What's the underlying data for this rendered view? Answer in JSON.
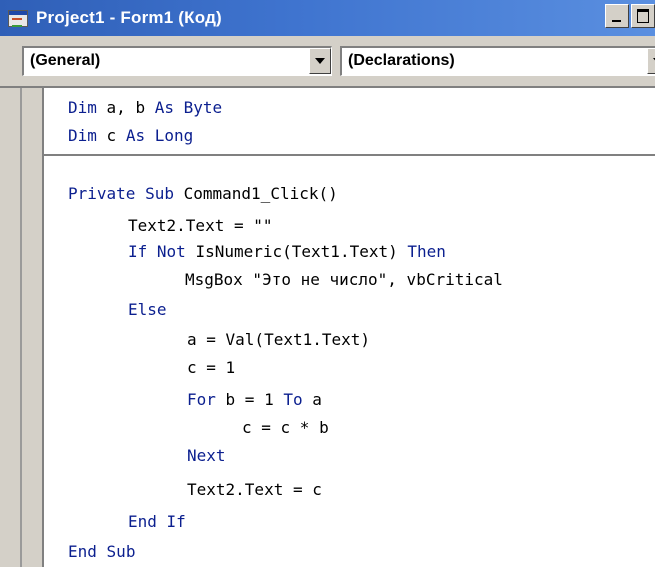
{
  "window": {
    "title": "Project1 - Form1 (Код)"
  },
  "combos": {
    "object_value": "(General)",
    "procedure_value": "(Declarations)"
  },
  "code": {
    "l1_kw1": "Dim",
    "l1_t1": " a, b ",
    "l1_kw2": "As",
    "l1_t2": " ",
    "l1_kw3": "Byte",
    "l2_kw1": "Dim",
    "l2_t1": " c ",
    "l2_kw2": "As",
    "l2_t2": " ",
    "l2_kw3": "Long",
    "l3_kw1": "Private",
    "l3_t1": " ",
    "l3_kw2": "Sub",
    "l3_t2": " Command1_Click()",
    "l4_t1": "Text2.Text = \"\"",
    "l5_kw1": "If",
    "l5_t1": " ",
    "l5_kw2": "Not",
    "l5_t2": " IsNumeric(Text1.Text) ",
    "l5_kw3": "Then",
    "l6_t1": "MsgBox \"Это не число\", vbCritical",
    "l7_kw1": "Else",
    "l8_t1": "a = Val(Text1.Text)",
    "l9_t1": "c = 1",
    "l10_kw1": "For",
    "l10_t1": " b = 1 ",
    "l10_kw2": "To",
    "l10_t2": " a",
    "l11_t1": "c = c * b",
    "l12_kw1": "Next",
    "l13_t1": "Text2.Text = c",
    "l14_kw1": "End",
    "l14_t1": " ",
    "l14_kw2": "If",
    "l15_kw1": "End",
    "l15_t1": " ",
    "l15_kw2": "Sub"
  },
  "colors": {
    "keyword": "#0b1f8f",
    "title_bar": "#3f74cf"
  },
  "icons": {
    "window_icon": "form-window-icon",
    "minimize": "minimize-icon",
    "maximize": "maximize-icon",
    "dropdown": "chevron-down-icon"
  }
}
